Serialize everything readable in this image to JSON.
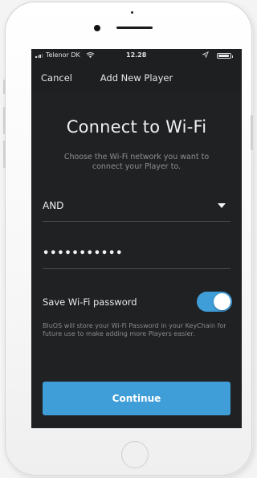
{
  "status_bar": {
    "carrier": "Telenor DK",
    "time": "12.28",
    "battery_level": 0.9,
    "icons": [
      "signal-icon",
      "wifi-icon",
      "location-icon",
      "battery-icon"
    ]
  },
  "nav": {
    "cancel_label": "Cancel",
    "title": "Add New Player"
  },
  "main": {
    "heading": "Connect to Wi-Fi",
    "subtitle": "Choose the Wi-Fi network you want to connect your Player to.",
    "network": {
      "selected": "AND",
      "icon": "chevron-down-icon"
    },
    "password": {
      "masked_value": "•••••••••••"
    },
    "save_password": {
      "label": "Save Wi-Fi password",
      "enabled": true
    },
    "note": "BluOS will store your Wi-Fi Password in your KeyChain for future use to make adding more Players easier.",
    "continue_label": "Continue"
  },
  "colors": {
    "accent": "#3f9dd8",
    "screen_background": "#1d1f21",
    "device_frame": "#ffffff"
  }
}
